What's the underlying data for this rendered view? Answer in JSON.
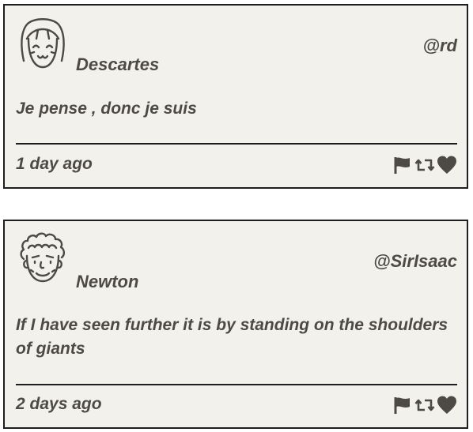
{
  "posts": [
    {
      "author": "Descartes",
      "handle": "@rd",
      "text": "Je pense , donc je suis",
      "time": "1 day ago",
      "avatar_icon": "woman-bangs-avatar-icon"
    },
    {
      "author": "Newton",
      "handle": "@SirIsaac",
      "text": "If I have seen further it is by standing on the shoulders of giants",
      "time": "2 days ago",
      "avatar_icon": "curly-hair-avatar-icon"
    }
  ],
  "actions": {
    "icons": [
      "flag-icon",
      "retweet-icon",
      "heart-icon"
    ]
  },
  "colors": {
    "card_background": "#f2f1ec",
    "border": "#1e1e1e",
    "text": "#4d4a45"
  }
}
